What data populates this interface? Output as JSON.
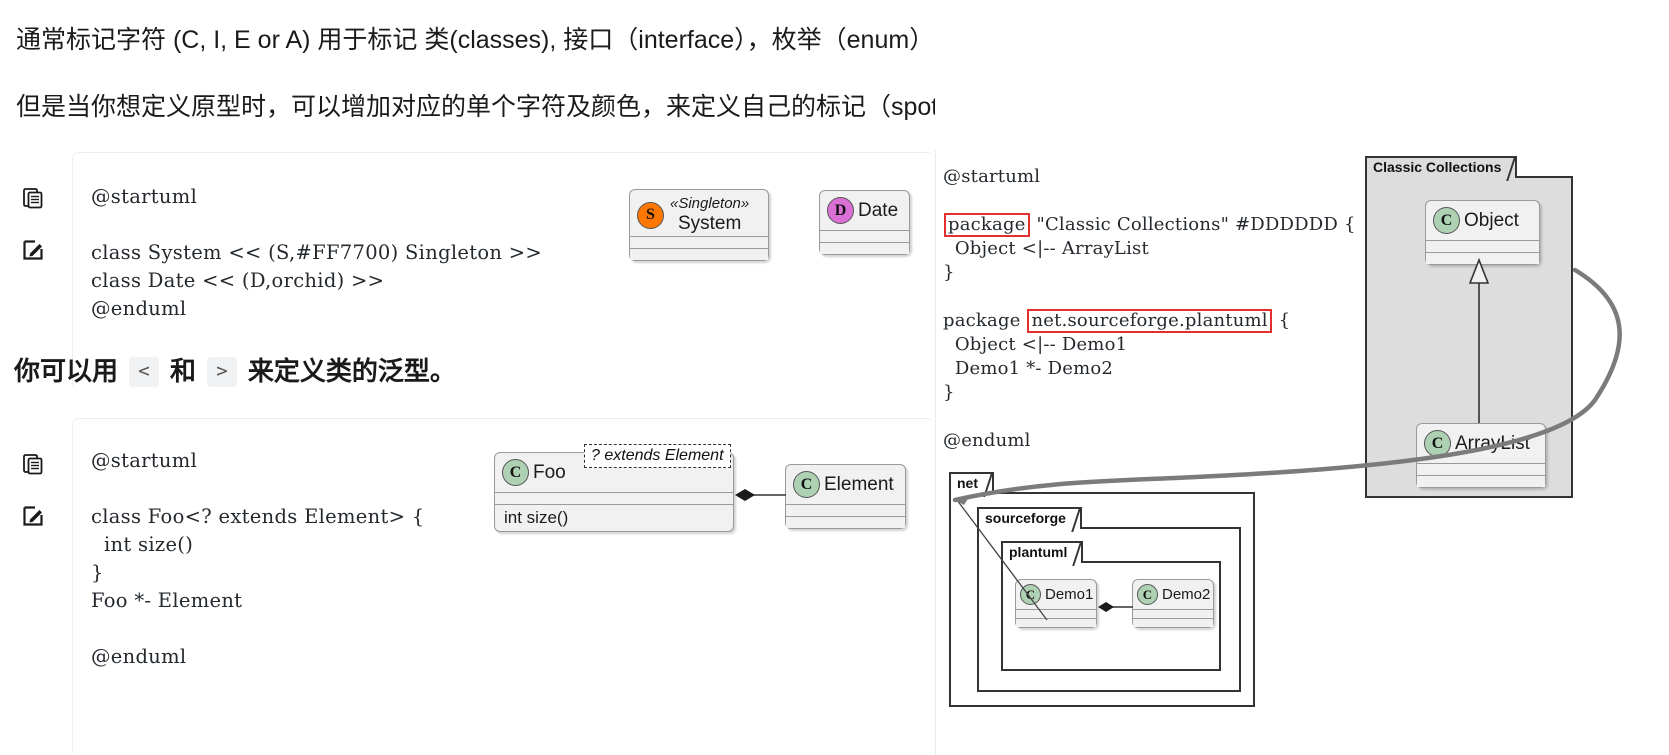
{
  "prose": {
    "line1": "通常标记字符 (C, I, E or A) 用于标记 类(classes), 接口（interface），枚举（enum）和 抽象类（abstract classes）",
    "line2": "但是当你想定义原型时，可以增加对应的单个字符及颜色，来定义自己的标记（spot），就像下面一样：",
    "line3_before": "你可以用",
    "line3_code1": "<",
    "line3_mid": "和",
    "line3_code2": ">",
    "line3_after": "来定义类的泛型。"
  },
  "icons": {
    "copy": "copy-icon",
    "edit": "edit-icon"
  },
  "code_block_1": "@startuml\n\nclass System << (S,#FF7700) Singleton >>\nclass Date << (D,orchid) >>\n@enduml",
  "code_block_2": "@startuml\n\nclass Foo<? extends Element> {\n  int size()\n}\nFoo *- Element\n\n@enduml",
  "code_block_right": {
    "l1": "@startuml",
    "l2_kw": "package",
    "l2_rest": " \"Classic Collections\" #DDDDDD {",
    "l3": "  Object <|-- ArrayList",
    "l4": "}",
    "l5": "",
    "l6_kw": "package",
    "l6_box": "net.sourceforge.plantuml",
    "l6_rest": " {",
    "l7": "  Object <|-- Demo1",
    "l8": "  Demo1 *- Demo2",
    "l9": "}",
    "l10": "",
    "l11": "@enduml"
  },
  "diagram_system": {
    "spot_letter": "S",
    "spot_color": "#FF7700",
    "stereotype": "«Singleton»",
    "name": "System"
  },
  "diagram_date": {
    "spot_letter": "D",
    "spot_color": "#DA70D6",
    "name": "Date"
  },
  "diagram_foo": {
    "foo_spot": "C",
    "foo_name": "Foo",
    "generic_note": "? extends Element",
    "foo_method": "int size()",
    "element_spot": "C",
    "element_name": "Element",
    "spot_color": "#ADD1B2"
  },
  "diagram_classic": {
    "package_label": "Classic Collections",
    "package_color": "#DDDDDD",
    "object_spot": "C",
    "object_name": "Object",
    "arraylist_spot": "C",
    "arraylist_name": "ArrayList"
  },
  "diagram_nested": {
    "pkg_net": "net",
    "pkg_sourceforge": "sourceforge",
    "pkg_plantuml": "plantuml",
    "demo1_spot": "C",
    "demo1_name": "Demo1",
    "demo2_spot": "C",
    "demo2_name": "Demo2"
  }
}
